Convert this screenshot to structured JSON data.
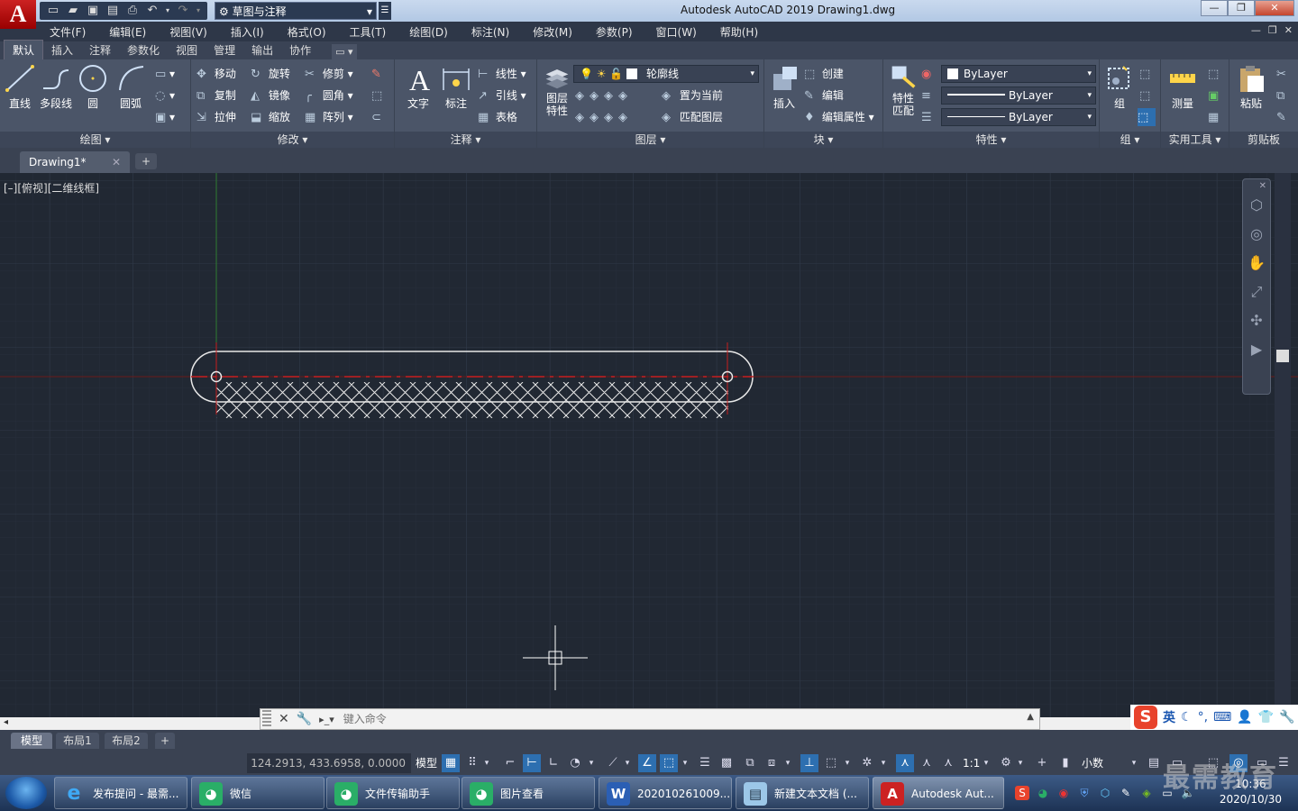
{
  "app": {
    "logo_letter": "A",
    "title": "Autodesk AutoCAD 2019    Drawing1.dwg",
    "workspace": "草图与注释"
  },
  "menu": [
    "文件(F)",
    "编辑(E)",
    "视图(V)",
    "插入(I)",
    "格式(O)",
    "工具(T)",
    "绘图(D)",
    "标注(N)",
    "修改(M)",
    "参数(P)",
    "窗口(W)",
    "帮助(H)"
  ],
  "ribbon_tabs": [
    "默认",
    "插入",
    "注释",
    "参数化",
    "视图",
    "管理",
    "输出",
    "协作"
  ],
  "ribbon": {
    "draw": {
      "title": "绘图",
      "line": "直线",
      "polyline": "多段线",
      "circle": "圆",
      "arc": "圆弧"
    },
    "modify": {
      "title": "修改",
      "move": "移动",
      "rotate": "旋转",
      "trim": "修剪",
      "copy": "复制",
      "mirror": "镜像",
      "fillet": "圆角",
      "stretch": "拉伸",
      "scale": "缩放",
      "array": "阵列"
    },
    "annotation": {
      "title": "注释",
      "text": "文字",
      "dimension": "标注",
      "linear": "线性",
      "leader": "引线",
      "table": "表格"
    },
    "layers": {
      "title": "图层",
      "layer_props": "图层特性",
      "current_layer": "轮廓线",
      "set_current": "置为当前",
      "match_layer": "匹配图层"
    },
    "block": {
      "title": "块",
      "insert": "插入",
      "create": "创建",
      "edit": "编辑",
      "edit_attr": "编辑属性"
    },
    "properties": {
      "title": "特性",
      "match": "特性匹配",
      "color": "ByLayer",
      "linetype": "ByLayer",
      "lineweight": "ByLayer"
    },
    "groups": {
      "title": "组",
      "group": "组"
    },
    "utilities": {
      "title": "实用工具",
      "measure": "测量"
    },
    "clipboard": {
      "title": "剪贴板",
      "paste": "粘贴"
    }
  },
  "file_tab": "Drawing1*",
  "viewport_label": "[–][俯视][二维线框]",
  "command_placeholder": "键入命令",
  "layout_tabs": [
    "模型",
    "布局1",
    "布局2"
  ],
  "status": {
    "coords": "124.2913, 433.6958, 0.0000",
    "model": "模型",
    "scale": "1:1",
    "units": "小数"
  },
  "ime": {
    "logo": "S",
    "lang": "英"
  },
  "taskbar": [
    {
      "label": "发布提问 - 最需...",
      "icon": "ie-icon"
    },
    {
      "label": "微信",
      "icon": "wechat-icon"
    },
    {
      "label": "文件传输助手",
      "icon": "wechat-icon"
    },
    {
      "label": "图片查看",
      "icon": "wechat-icon"
    },
    {
      "label": "202010261009...",
      "icon": "word-icon"
    },
    {
      "label": "新建文本文档 (...",
      "icon": "notepad-icon"
    },
    {
      "label": "Autodesk Aut...",
      "icon": "autocad-icon"
    }
  ],
  "clock": {
    "time": "10:36",
    "date": "2020/10/30"
  },
  "watermark": "最需教育",
  "colors": {
    "canvas_bg": "#212833",
    "ribbon_bg": "#4b5568",
    "center_line": "#c81e1e",
    "drawing_line": "#ffffff",
    "accent_blue": "#2d6fb0"
  }
}
